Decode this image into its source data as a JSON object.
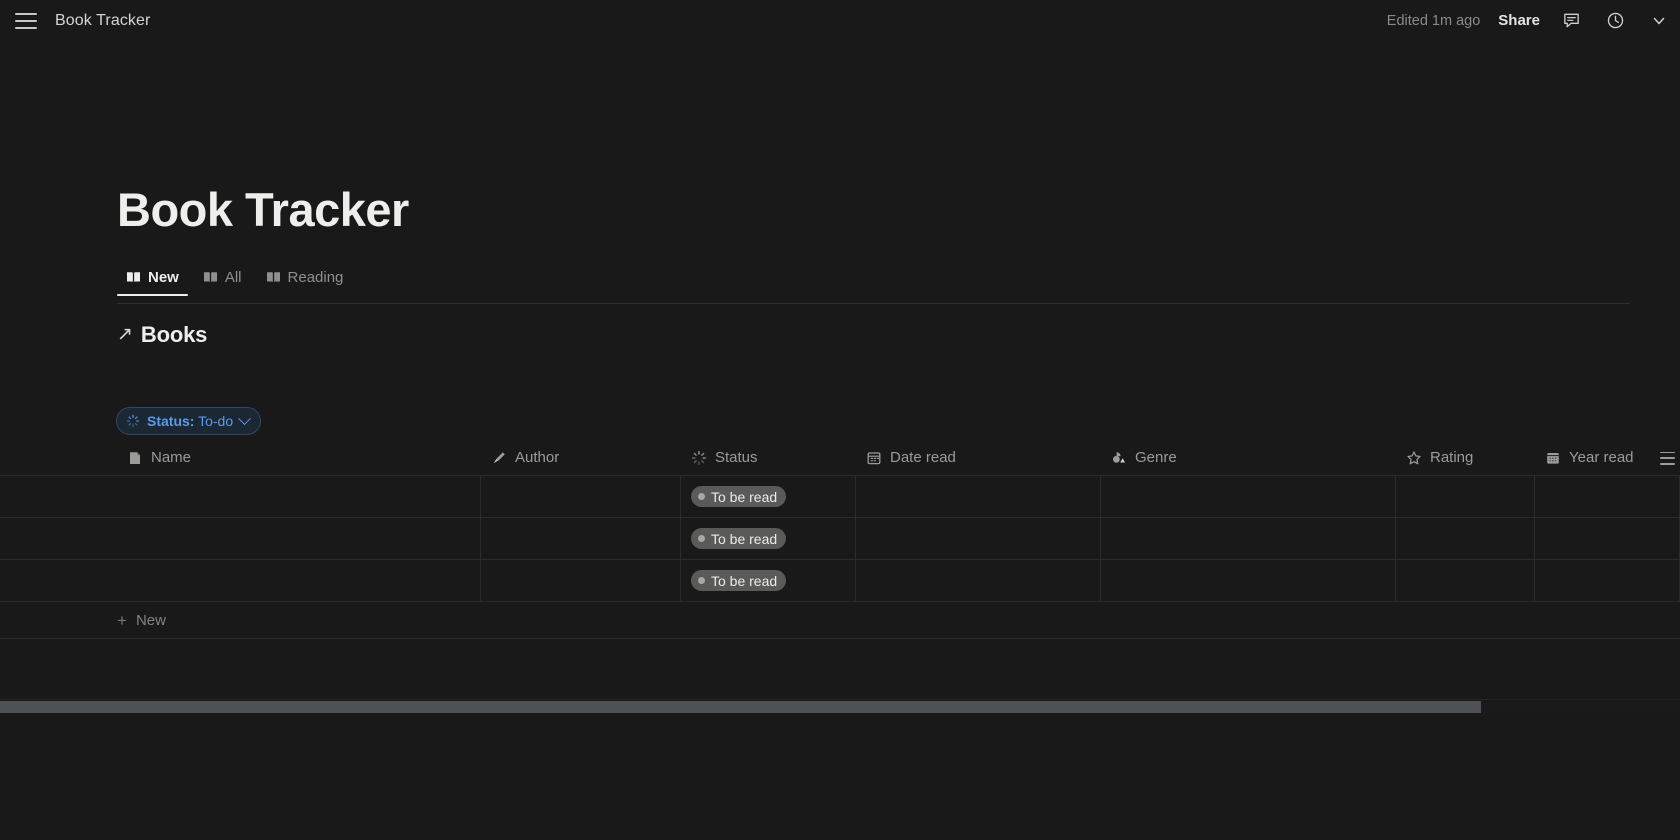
{
  "topbar": {
    "menu_icon": "hamburger-icon",
    "doc_title": "Book Tracker",
    "edited": "Edited 1m ago",
    "share_label": "Share",
    "comment_icon": "comment-icon",
    "history_icon": "clock-icon",
    "more_icon": "chevron-down-icon"
  },
  "main": {
    "page_title": "Book Tracker",
    "tabs": [
      {
        "label": "New",
        "icon": "book-icon",
        "active": true
      },
      {
        "label": "All",
        "icon": "book-icon",
        "active": false
      },
      {
        "label": "Reading",
        "icon": "book-icon",
        "active": false
      }
    ],
    "database": {
      "link_icon": "arrow-up-right-icon",
      "name": "Books",
      "filter": {
        "icon": "status-spinner-icon",
        "property": "Status:",
        "value": "To-do",
        "chevron_icon": "chevron-down-icon",
        "accent": "#5b9aec",
        "border": "#2d4a6b",
        "background": "#1b2733"
      },
      "columns": [
        {
          "label": "Name",
          "icon": "page-icon"
        },
        {
          "label": "Author",
          "icon": "pen-icon"
        },
        {
          "label": "Status",
          "icon": "status-spinner-icon"
        },
        {
          "label": "Date read",
          "icon": "calendar-icon"
        },
        {
          "label": "Genre",
          "icon": "multi-select-icon"
        },
        {
          "label": "Rating",
          "icon": "star-icon"
        },
        {
          "label": "Year read",
          "icon": "calendar-icon"
        }
      ],
      "rows": [
        {
          "name": "",
          "author": "",
          "status": "To be read",
          "date_read": "",
          "genre": "",
          "rating": "",
          "year_read": ""
        },
        {
          "name": "",
          "author": "",
          "status": "To be read",
          "date_read": "",
          "genre": "",
          "rating": "",
          "year_read": ""
        },
        {
          "name": "",
          "author": "",
          "status": "To be read",
          "date_read": "",
          "genre": "",
          "rating": "",
          "year_read": ""
        }
      ],
      "new_row_label": "New",
      "new_row_icon": "plus-icon",
      "options_icon": "list-menu-icon",
      "status_pill_color": "#5a5a58"
    }
  },
  "scrollbar": {
    "orientation": "horizontal",
    "thumb_color": "#4e5257"
  }
}
